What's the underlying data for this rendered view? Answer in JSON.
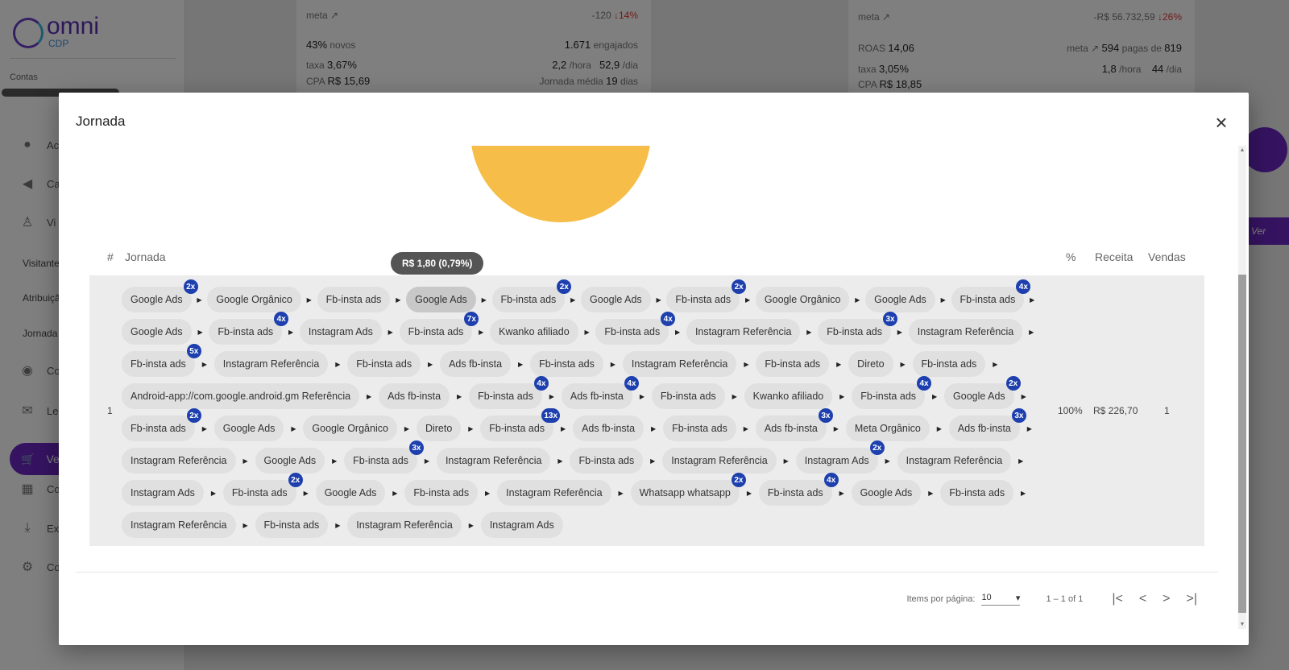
{
  "app": {
    "logo_text": "omni",
    "logo_sub": "CDP",
    "contas_label": "Contas",
    "sidebar_items": [
      "Ac",
      "Ca",
      "Vi",
      "Co",
      "Le",
      "Ve",
      "Co",
      "Ex",
      "Co"
    ],
    "sidebar_subitems": [
      "Visitante",
      "Atribuiçã",
      "Jornada"
    ]
  },
  "background_cards": [
    {
      "meta": "meta",
      "meta_delta": "-120",
      "meta_pct": "14%",
      "new_pct": "43%",
      "new_label": "novos",
      "engaged_value": "1.671",
      "engaged_label": "engajados",
      "rate_label": "taxa",
      "rate_value": "3,67%",
      "per_hour": "2,2",
      "per_hour_label": "/hora",
      "per_day": "52,9",
      "per_day_label": "/dia",
      "cpa_label": "CPA",
      "cpa_value": "R$ 15,69",
      "journey_label": "Jornada média",
      "journey_days": "19",
      "journey_unit": "dias"
    },
    {
      "meta": "meta",
      "meta_delta": "-R$ 56.732,59",
      "meta_pct": "26%",
      "roas_label": "ROAS",
      "roas_value": "14,06",
      "meta_paid_label": "meta",
      "paid_value": "594",
      "paid_label": "pagas de",
      "paid_total": "819",
      "rate_label": "taxa",
      "rate_value": "3,05%",
      "per_hour": "1,8",
      "per_hour_label": "/hora",
      "per_day": "44",
      "per_day_label": "/dia",
      "cpa_label": "CPA",
      "cpa_value": "R$ 18,85"
    }
  ],
  "background_buttons": {
    "ver_label": "Ver"
  },
  "modal": {
    "title": "Jornada",
    "close_icon": "close-icon",
    "pie_color": "#f6be48",
    "tooltip": "R$ 1,80 (0,79%)",
    "columns": {
      "num": "#",
      "journey": "Jornada",
      "pct": "%",
      "revenue": "Receita",
      "sales": "Vendas"
    },
    "row": {
      "num": "1",
      "pct": "100%",
      "revenue": "R$ 226,70",
      "sales": "1"
    },
    "journey_rows": [
      [
        {
          "label": "Google Ads",
          "badge": "2x"
        },
        {
          "label": "Google Orgânico",
          "badge": ""
        },
        {
          "label": "Fb-insta ads",
          "badge": ""
        },
        {
          "label": "Google Ads",
          "badge": "",
          "highlight": true
        },
        {
          "label": "Fb-insta ads",
          "badge": "2x"
        },
        {
          "label": "Google Ads",
          "badge": ""
        },
        {
          "label": "Fb-insta ads",
          "badge": "2x"
        },
        {
          "label": "Google Orgânico",
          "badge": ""
        },
        {
          "label": "Google Ads",
          "badge": ""
        },
        {
          "label": "Fb-insta ads",
          "badge": "4x"
        }
      ],
      [
        {
          "label": "Google Ads",
          "badge": ""
        },
        {
          "label": "Fb-insta ads",
          "badge": "4x"
        },
        {
          "label": "Instagram Ads",
          "badge": ""
        },
        {
          "label": "Fb-insta ads",
          "badge": "7x"
        },
        {
          "label": "Kwanko afiliado",
          "badge": ""
        },
        {
          "label": "Fb-insta ads",
          "badge": "4x"
        },
        {
          "label": "Instagram Referência",
          "badge": ""
        },
        {
          "label": "Fb-insta ads",
          "badge": "3x"
        },
        {
          "label": "Instagram Referência",
          "badge": ""
        }
      ],
      [
        {
          "label": "Fb-insta ads",
          "badge": "5x"
        },
        {
          "label": "Instagram Referência",
          "badge": ""
        },
        {
          "label": "Fb-insta ads",
          "badge": ""
        },
        {
          "label": "Ads fb-insta",
          "badge": ""
        },
        {
          "label": "Fb-insta ads",
          "badge": ""
        },
        {
          "label": "Instagram Referência",
          "badge": ""
        },
        {
          "label": "Fb-insta ads",
          "badge": ""
        },
        {
          "label": "Direto",
          "badge": ""
        },
        {
          "label": "Fb-insta ads",
          "badge": ""
        }
      ],
      [
        {
          "label": "Android-app://com.google.android.gm Referência",
          "badge": ""
        },
        {
          "label": "Ads fb-insta",
          "badge": ""
        },
        {
          "label": "Fb-insta ads",
          "badge": "4x"
        },
        {
          "label": "Ads fb-insta",
          "badge": "4x"
        },
        {
          "label": "Fb-insta ads",
          "badge": ""
        },
        {
          "label": "Kwanko afiliado",
          "badge": ""
        },
        {
          "label": "Fb-insta ads",
          "badge": "4x"
        },
        {
          "label": "Google Ads",
          "badge": "2x"
        }
      ],
      [
        {
          "label": "Fb-insta ads",
          "badge": "2x"
        },
        {
          "label": "Google Ads",
          "badge": ""
        },
        {
          "label": "Google Orgânico",
          "badge": ""
        },
        {
          "label": "Direto",
          "badge": ""
        },
        {
          "label": "Fb-insta ads",
          "badge": "13x"
        },
        {
          "label": "Ads fb-insta",
          "badge": ""
        },
        {
          "label": "Fb-insta ads",
          "badge": ""
        },
        {
          "label": "Ads fb-insta",
          "badge": "3x"
        },
        {
          "label": "Meta Orgânico",
          "badge": ""
        },
        {
          "label": "Ads fb-insta",
          "badge": "3x"
        }
      ],
      [
        {
          "label": "Instagram Referência",
          "badge": ""
        },
        {
          "label": "Google Ads",
          "badge": ""
        },
        {
          "label": "Fb-insta ads",
          "badge": "3x"
        },
        {
          "label": "Instagram Referência",
          "badge": ""
        },
        {
          "label": "Fb-insta ads",
          "badge": ""
        },
        {
          "label": "Instagram Referência",
          "badge": ""
        },
        {
          "label": "Instagram Ads",
          "badge": "2x"
        },
        {
          "label": "Instagram Referência",
          "badge": ""
        }
      ],
      [
        {
          "label": "Instagram Ads",
          "badge": ""
        },
        {
          "label": "Fb-insta ads",
          "badge": "2x"
        },
        {
          "label": "Google Ads",
          "badge": ""
        },
        {
          "label": "Fb-insta ads",
          "badge": ""
        },
        {
          "label": "Instagram Referência",
          "badge": ""
        },
        {
          "label": "Whatsapp whatsapp",
          "badge": "2x"
        },
        {
          "label": "Fb-insta ads",
          "badge": "4x"
        },
        {
          "label": "Google Ads",
          "badge": ""
        },
        {
          "label": "Fb-insta ads",
          "badge": ""
        }
      ],
      [
        {
          "label": "Instagram Referência",
          "badge": ""
        },
        {
          "label": "Fb-insta ads",
          "badge": ""
        },
        {
          "label": "Instagram Referência",
          "badge": ""
        },
        {
          "label": "Instagram Ads",
          "badge": ""
        }
      ]
    ],
    "paginator": {
      "items_label": "Items por página:",
      "page_size": "10",
      "range": "1 – 1 of 1",
      "first_icon": "|<",
      "prev_icon": "<",
      "next_icon": ">",
      "last_icon": ">|"
    }
  },
  "colors": {
    "brand": "#6a27c2",
    "badge": "#1e40af",
    "chip": "#e0e0e0"
  }
}
